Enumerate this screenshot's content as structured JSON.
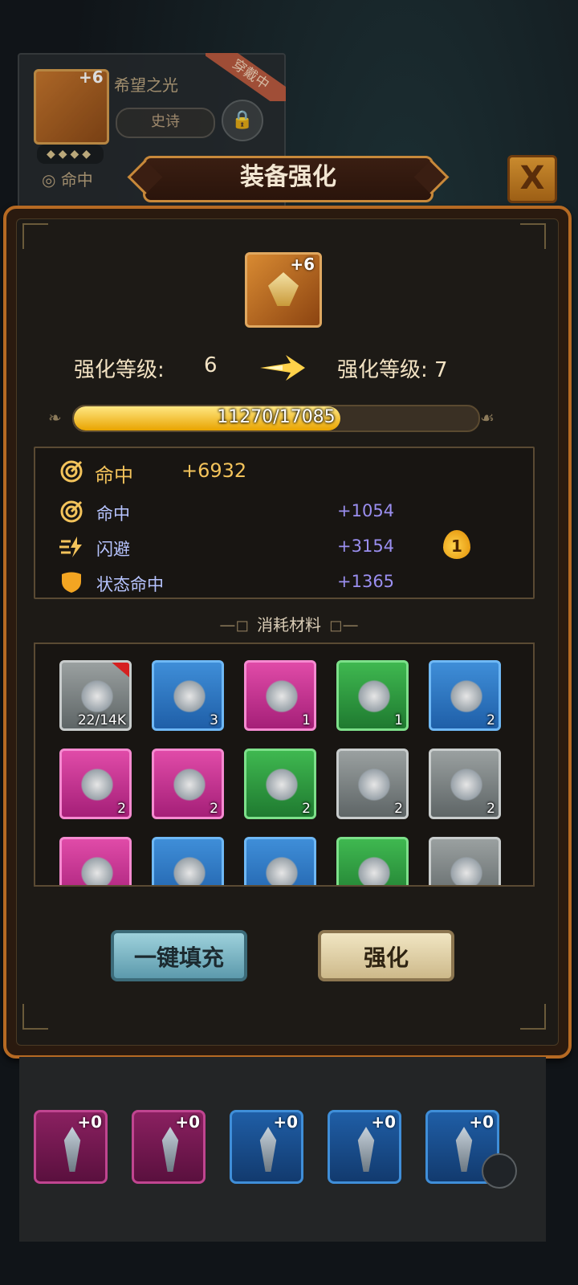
{
  "background_card": {
    "item_name": "希望之光",
    "plus_level": "+6",
    "rarity": "史诗",
    "equipped_ribbon": "穿戴中",
    "stars": "◆◆◆◆",
    "stat_label": "命中",
    "lock_icon": "lock-icon"
  },
  "dialog": {
    "title": "装备强化",
    "close_label": "X",
    "item_plus": "+6",
    "current_level_label": "强化等级:",
    "current_level_value": "6",
    "next_level_text": "强化等级: 7",
    "progress": {
      "text": "11270/17085",
      "current": 11270,
      "max": 17085
    },
    "main_stat": {
      "label": "命中",
      "value": "+6932",
      "icon": "target-icon"
    },
    "sub_stats": [
      {
        "label": "命中",
        "value": "+1054",
        "icon": "target-icon"
      },
      {
        "label": "闪避",
        "value": "+3154",
        "icon": "dodge-icon"
      },
      {
        "label": "状态命中",
        "value": "+1365",
        "icon": "shield-icon"
      }
    ],
    "fire_badge_value": "1",
    "materials_title": "消耗材料",
    "materials": [
      {
        "name": "crystal",
        "rarity": "gray",
        "count": "22/14K"
      },
      {
        "name": "necklace",
        "rarity": "blue",
        "count": "3"
      },
      {
        "name": "amulet",
        "rarity": "pink",
        "count": "1"
      },
      {
        "name": "ring",
        "rarity": "green",
        "count": "1"
      },
      {
        "name": "ring",
        "rarity": "blue",
        "count": "2"
      },
      {
        "name": "boots",
        "rarity": "pink",
        "count": "2"
      },
      {
        "name": "ring",
        "rarity": "pink",
        "count": "2"
      },
      {
        "name": "armor",
        "rarity": "green",
        "count": "2"
      },
      {
        "name": "hood",
        "rarity": "gray",
        "count": "2"
      },
      {
        "name": "scarf",
        "rarity": "gray",
        "count": "2"
      },
      {
        "name": "helmet",
        "rarity": "pink",
        "count": ""
      },
      {
        "name": "ring",
        "rarity": "blue",
        "count": ""
      },
      {
        "name": "cloak",
        "rarity": "blue",
        "count": ""
      },
      {
        "name": "boots",
        "rarity": "green",
        "count": ""
      },
      {
        "name": "bandana",
        "rarity": "gray",
        "count": ""
      }
    ],
    "autofill_button": "一键填充",
    "upgrade_button": "强化"
  },
  "inventory_bottom": [
    {
      "plus": "+0",
      "rarity": "pink"
    },
    {
      "plus": "+0",
      "rarity": "pink"
    },
    {
      "plus": "+0",
      "rarity": "blue"
    },
    {
      "plus": "+0",
      "rarity": "blue"
    },
    {
      "plus": "+0",
      "rarity": "blue"
    }
  ],
  "colors": {
    "accent_gold": "#f3c35b",
    "panel_border": "#b66a23",
    "substat_value": "#9b8ff0"
  }
}
